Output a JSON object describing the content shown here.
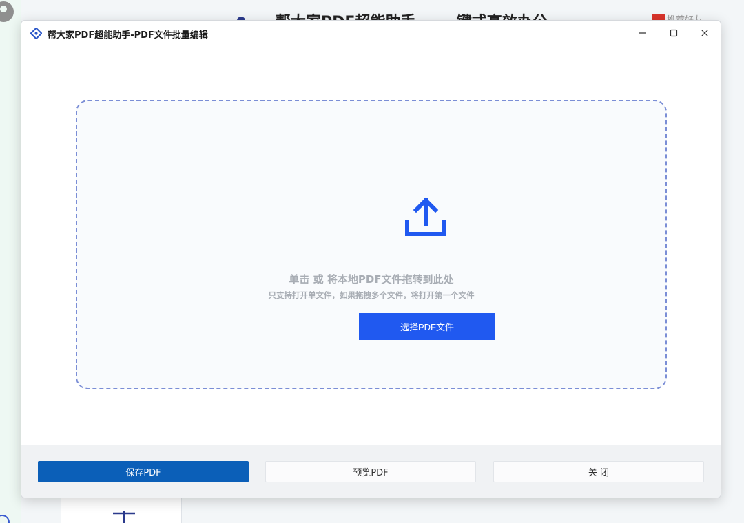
{
  "background": {
    "headline": "帮大家PDF超能助手 — 一键式高效办公",
    "topright_text": "推荐好友"
  },
  "window": {
    "title": "帮大家PDF超能助手-PDF文件批量编辑",
    "controls": {
      "minimize": "—",
      "maximize": "☐",
      "close": "✕"
    }
  },
  "dropzone": {
    "main_text": "单击 或 将本地PDF文件拖转到此处",
    "sub_text": "只支持打开单文件，如果拖拽多个文件，将打开第一个文件",
    "select_button_label": "选择PDF文件"
  },
  "footer": {
    "save_label": "保存PDF",
    "preview_label": "预览PDF",
    "close_label": "关 闭"
  },
  "colors": {
    "accent": "#2059f0",
    "save_button": "#0b5fb8",
    "dash_border": "#7b8ed6",
    "hint_text": "#a8adb4"
  }
}
